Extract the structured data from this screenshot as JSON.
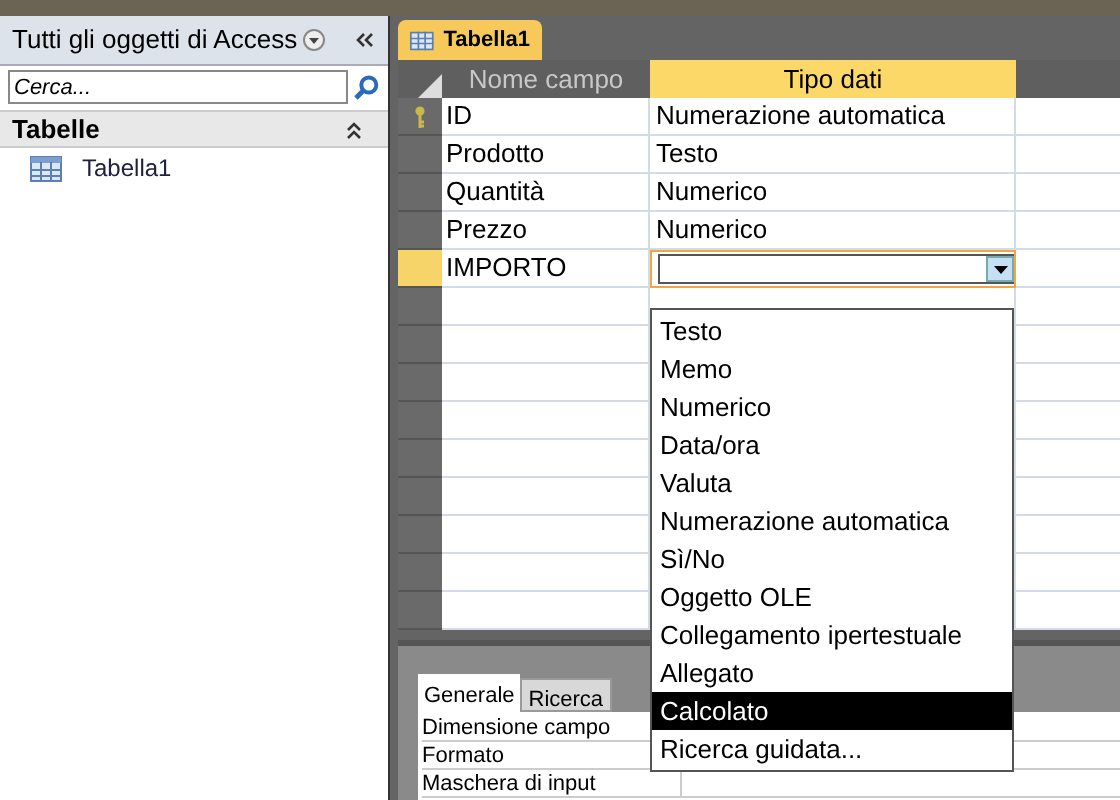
{
  "navigation_pane": {
    "title": "Tutti gli oggetti di Access",
    "search": {
      "placeholder": "Cerca..."
    },
    "groups": [
      {
        "label": "Tabelle",
        "items": [
          {
            "label": "Tabella1"
          }
        ]
      }
    ]
  },
  "document_tab": {
    "label": "Tabella1"
  },
  "table": {
    "columns": [
      "Nome campo",
      "Tipo dati"
    ],
    "rows": [
      {
        "field": "ID",
        "type": "Numerazione automatica",
        "primary_key": true,
        "selected": false
      },
      {
        "field": "Prodotto",
        "type": "Testo",
        "primary_key": false,
        "selected": false
      },
      {
        "field": "Quantità",
        "type": "Numerico",
        "primary_key": false,
        "selected": false
      },
      {
        "field": "Prezzo",
        "type": "Numerico",
        "primary_key": false,
        "selected": false
      },
      {
        "field": "IMPORTO",
        "type": "",
        "primary_key": false,
        "selected": true
      }
    ]
  },
  "dropdown": {
    "options": [
      {
        "label": "Testo",
        "selected": false
      },
      {
        "label": "Memo",
        "selected": false
      },
      {
        "label": "Numerico",
        "selected": false
      },
      {
        "label": "Data/ora",
        "selected": false
      },
      {
        "label": "Valuta",
        "selected": false
      },
      {
        "label": "Numerazione automatica",
        "selected": false
      },
      {
        "label": "Sì/No",
        "selected": false
      },
      {
        "label": "Oggetto OLE",
        "selected": false
      },
      {
        "label": "Collegamento ipertestuale",
        "selected": false
      },
      {
        "label": "Allegato",
        "selected": false
      },
      {
        "label": "Calcolato",
        "selected": true
      },
      {
        "label": "Ricerca guidata...",
        "selected": false
      }
    ]
  },
  "properties": {
    "tabs": [
      {
        "label": "Generale",
        "selected": true
      },
      {
        "label": "Ricerca",
        "selected": false
      }
    ],
    "rows": [
      "Dimensione campo",
      "Formato",
      "Maschera di input"
    ]
  }
}
